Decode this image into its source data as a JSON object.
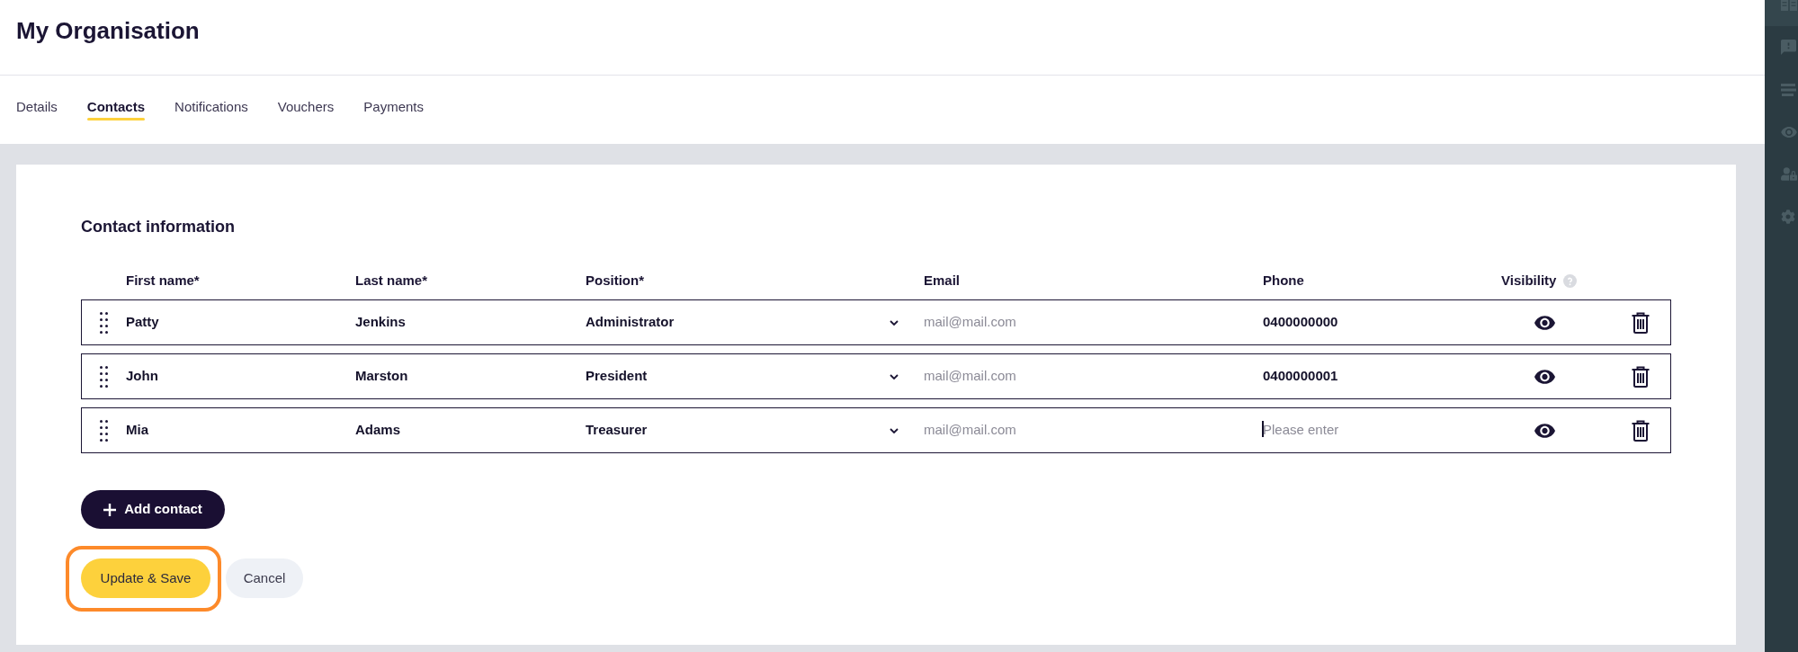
{
  "header": {
    "title": "My Organisation"
  },
  "tabs": [
    {
      "label": "Details",
      "selected": false
    },
    {
      "label": "Contacts",
      "selected": true
    },
    {
      "label": "Notifications",
      "selected": false
    },
    {
      "label": "Vouchers",
      "selected": false
    },
    {
      "label": "Payments",
      "selected": false
    }
  ],
  "contacts": {
    "heading": "Contact information",
    "columns": [
      {
        "label": "First name*",
        "help": false
      },
      {
        "label": "Last name*",
        "help": false
      },
      {
        "label": "Position*",
        "help": false
      },
      {
        "label": "Email",
        "help": false
      },
      {
        "label": "Phone",
        "help": false
      },
      {
        "label": "Visibility",
        "help": true
      }
    ],
    "rows": [
      {
        "first_name": "Patty",
        "last_name": "Jenkins",
        "position": "Administrator",
        "email": {
          "placeholder": "mail@mail.com"
        },
        "phone": {
          "value": "0400000000",
          "focused": false
        },
        "visible": true
      },
      {
        "first_name": "John",
        "last_name": "Marston",
        "position": "President",
        "email": {
          "placeholder": "mail@mail.com"
        },
        "phone": {
          "value": "0400000001",
          "focused": false
        },
        "visible": true
      },
      {
        "first_name": "Mia",
        "last_name": "Adams",
        "position": "Treasurer",
        "email": {
          "placeholder": "mail@mail.com"
        },
        "phone": {
          "placeholder": "Please enter",
          "focused": true
        },
        "visible": true
      }
    ],
    "add_button": {
      "label": "Add contact"
    }
  },
  "actions": [
    {
      "label": "Update & Save",
      "kind": "primary",
      "highlighted": true
    },
    {
      "label": "Cancel",
      "kind": "secondary",
      "highlighted": false
    }
  ],
  "sidebar": {
    "items": [
      {
        "selected": true
      },
      {
        "selected": false
      },
      {
        "selected": false
      },
      {
        "selected": false
      },
      {
        "selected": false
      },
      {
        "selected": false
      }
    ]
  }
}
